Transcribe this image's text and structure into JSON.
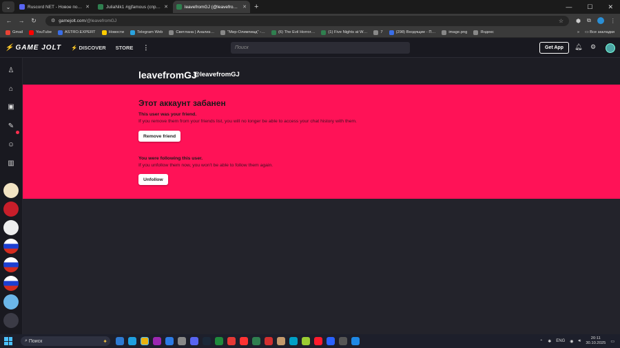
{
  "browser": {
    "tabs": [
      {
        "title": "Ruscord NET - Новое поколение",
        "color": "#5865f2",
        "active": false
      },
      {
        "title": "JuliaNik1 #gjfamous (спрей сп…",
        "color": "#2f7f4f",
        "active": false
      },
      {
        "title": "leavefromGJ (@leavefromGJ)",
        "color": "#2f7f4f",
        "active": true
      }
    ],
    "new_tab": "+",
    "url_host": "gamejolt.com",
    "url_path": "/@leavefromGJ",
    "bookmarks": [
      {
        "label": "Gmail",
        "color": "#ea4335"
      },
      {
        "label": "YouTube",
        "color": "#ff0000"
      },
      {
        "label": "ASTRO.EXPERT",
        "color": "#3a6ee8"
      },
      {
        "label": "Новости",
        "color": "#ffcc00"
      },
      {
        "label": "Telegram Web",
        "color": "#2aa3e0"
      },
      {
        "label": "Светлана | Анализ…",
        "color": "#888888"
      },
      {
        "label": "\"Мир-Олимпиад\" -…",
        "color": "#888888"
      },
      {
        "label": "(6) The Evil Horror…",
        "color": "#2f7f4f"
      },
      {
        "label": "(1) Five Nights at W…",
        "color": "#2f7f4f"
      },
      {
        "label": "7",
        "color": "#888888"
      },
      {
        "label": "(298) Входящие - П…",
        "color": "#3a6ee8"
      },
      {
        "label": "image.png",
        "color": "#888888"
      },
      {
        "label": "Яндекс",
        "color": "#888888"
      }
    ],
    "all_bookmarks": "Все закладки"
  },
  "gj_header": {
    "logo": "GAME JOLT",
    "nav": [
      {
        "label": "DISCOVER",
        "icon": "bolt-icon"
      },
      {
        "label": "STORE"
      }
    ],
    "search_placeholder": "Поиск",
    "get_app": "Get App"
  },
  "profile": {
    "name": "leavefromGJ",
    "handle": "@leavefromGJ"
  },
  "banned": {
    "title": "Этот аккаунт забанен",
    "friend_heading": "This user was your friend.",
    "friend_text": "If you remove them from your friends list, you will no longer be able to access your chat history with them.",
    "remove_friend": "Remove friend",
    "follow_heading": "You were following this user.",
    "follow_text": "If you unfollow them now, you won't be able to follow them again.",
    "unfollow": "Unfollow",
    "bg_color": "#ff1257"
  },
  "taskbar": {
    "search": "Поиск",
    "lang": "ENG",
    "time": "20:11",
    "date": "30.10.2025"
  }
}
